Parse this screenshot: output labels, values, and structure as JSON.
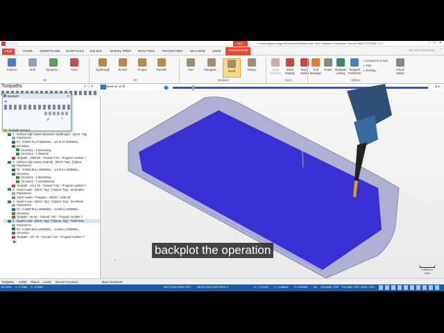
{
  "titlebar": {
    "app_label": "MILL",
    "path": "C:\\Users\\jpanes.gngnd\\Downloads\\Mastercam 2019 Multiaxis Essentials Tutorial Files\\TUTORIAL 7.m...",
    "account": "MY MASTERCAM"
  },
  "tabs": [
    "FILE",
    "HOME",
    "WIREFRAME",
    "SURFACES",
    "SOLIDS",
    "MODEL PREP",
    "DRAFTING",
    "TRANSFORM",
    "MACHINE",
    "VIEW",
    "TOOLPATHS"
  ],
  "ribbon": {
    "buttons_2d": [
      "Contour",
      "Drill",
      "Dynamic ...",
      "Face"
    ],
    "group_2d": "2D",
    "buttons_3d": [
      "OptiRough",
      "Pocket",
      "Project",
      "Parallel"
    ],
    "group_3d": "3D",
    "buttons_multiaxis": [
      "Port",
      "Triangular ...",
      "Swarf",
      "Rotary"
    ],
    "group_multiaxis": "Multiaxis",
    "buttons_stock": [
      "Stock Shading",
      "Stock Display",
      "Stock Model"
    ],
    "group_stock": "Stock",
    "buttons_utilities": [
      "Tool Manager",
      "Probe",
      "Multiaxis Linking",
      "Toolpath Transform"
    ],
    "utility_small": [
      "Convert to 5-axis",
      "Trim",
      "Nesting"
    ],
    "check_holder": "Check Holder",
    "group_utilities": "Utilities"
  },
  "panel": {
    "title": "Toolpaths"
  },
  "backplot": {
    "title": "Backplot"
  },
  "tree": [
    "Toolpath Group-1",
    "1 - Surface High Speed (Dynamic OptiRough) - [WCS: Top]",
    "Parameters",
    "#1 - 0.5000 FLAT ENDMILL - 1/2 FLAT ENDMILL",
    "Geometry",
    "Geometry - 1 Machining",
    "Geometry - 1 Material",
    "Toolpath - 2298.9K - Tutorial 7.NC - Program number 7",
    "2 - Surface High Speed (Hybrid) - [WCS: Top] - [Tplane",
    "Parameters",
    "#2 - 0.5000 BALL ENDMILL - 1/2 BALL ENDMILL",
    "Geometry",
    "Geometry - 1 Machining",
    "Geometry - 1 Containment",
    "Toolpath - 1412.4K - Tutorial 7.NC - Program number 7",
    "3 - Stock model - [WCS: Top] - [Tplane: Top] - Stock after",
    "Parameters",
    "Stock model - Triangles = 99140 - 1346.3K",
    "4 - Swarf 5 Axis - [WCS: Top] - [Tplane: Top] - Semifinish",
    "Parameters",
    "#3 - 0.2500 BALL ENDMILL - 1/4 BALL ENDMILL",
    "Geometry",
    "Toolpath - 99.4K - Tutorial 7.NC - Program number 7",
    "5 - Swarf 5 Axis - [WCS: Top] - [Tplane: Top] - Finish Pas",
    "Parameters",
    "#3 - 0.2500 BALL ENDMILL - 1/4 BALL ENDMILL",
    "Geometry",
    "Toolpath - 197.7K - Tutorial 7.NC - Program number 7"
  ],
  "bottom_tabs": [
    "Toolpaths",
    "Solids",
    "Planes",
    "Levels",
    "Recent Functions"
  ],
  "viewsheet": "Main Viewsheet",
  "scale_text": [
    "0.8903 in",
    "Inch"
  ],
  "status": {
    "x_left": "82.2391",
    "y_left": "X: 2.2366",
    "z_left": "Z: -0.9881",
    "section_view": "SECTION VIEW: OFF",
    "selected": "SELECTED ENTITIES: 0",
    "x": "X:  -7.37215",
    "y": "Y:  -2.58618",
    "z": "Z:  0.00000",
    "mode": "3D",
    "cplane": "CPLANE: TOP",
    "tplane": "TPLANE: TOP",
    "wcs": "WCS: TOP"
  },
  "subtitle": "backplot the operation"
}
